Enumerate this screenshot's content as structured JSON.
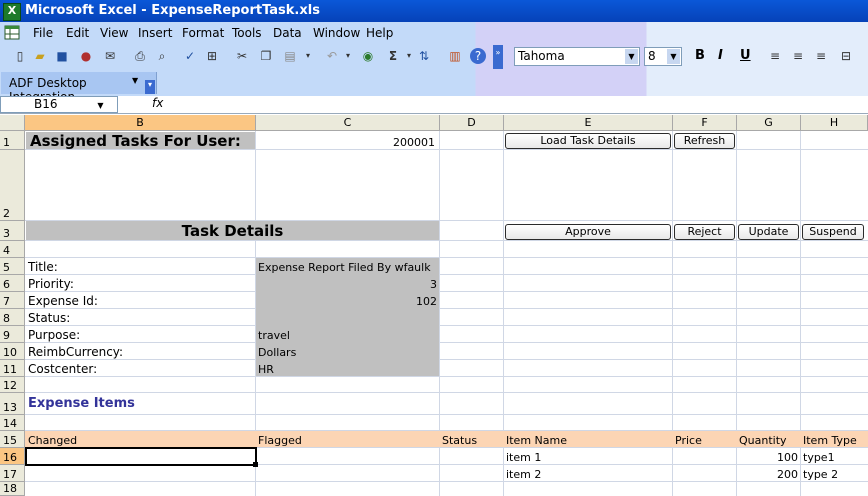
{
  "window": {
    "title": "Microsoft Excel - ExpenseReportTask.xls",
    "app_icon": "excel-icon"
  },
  "menu": [
    "File",
    "Edit",
    "View",
    "Insert",
    "Format",
    "Tools",
    "Data",
    "Window",
    "Help"
  ],
  "toolbar": {
    "font": "Tahoma",
    "size": "8",
    "bold": "B",
    "italic": "I",
    "underline": "U",
    "sigma": "Σ"
  },
  "adf": {
    "label": "ADF Desktop Integration"
  },
  "formula": {
    "namebox": "B16",
    "fx": "fx",
    "content": ""
  },
  "columns": [
    "B",
    "C",
    "D",
    "E",
    "F",
    "G",
    "H"
  ],
  "selected_column": "B",
  "rows": [
    "1",
    "2",
    "3",
    "4",
    "5",
    "6",
    "7",
    "8",
    "9",
    "10",
    "11",
    "12",
    "13",
    "14",
    "15",
    "16",
    "17",
    "18"
  ],
  "selected_row": "16",
  "sheet": {
    "assigned_title": "Assigned Tasks For User:",
    "user_id": "200001",
    "task_details_title": "Task Details",
    "buttons": {
      "load": "Load Task Details",
      "refresh": "Refresh",
      "approve": "Approve",
      "reject": "Reject",
      "update": "Update",
      "suspend": "Suspend"
    },
    "fields": [
      {
        "label": "Title:",
        "value": "Expense Report Filed By wfaulk",
        "align": "left"
      },
      {
        "label": "Priority:",
        "value": "3",
        "align": "right"
      },
      {
        "label": "Expense Id:",
        "value": "102",
        "align": "right"
      },
      {
        "label": "Status:",
        "value": "",
        "align": "left"
      },
      {
        "label": "Purpose:",
        "value": "travel",
        "align": "left"
      },
      {
        "label": "ReimbCurrency:",
        "value": "Dollars",
        "align": "left"
      },
      {
        "label": "Costcenter:",
        "value": "HR",
        "align": "left"
      }
    ],
    "expense_items_title": "Expense Items",
    "table_headers": {
      "changed": "Changed",
      "flagged": "Flagged",
      "status": "Status",
      "item_name": "Item Name",
      "price": "Price",
      "quantity": "Quantity",
      "item_type": "Item Type"
    },
    "items": [
      {
        "item_name": "item 1",
        "quantity": "100",
        "item_type": "type1"
      },
      {
        "item_name": "item 2",
        "quantity": "200",
        "item_type": "type 2"
      }
    ]
  }
}
